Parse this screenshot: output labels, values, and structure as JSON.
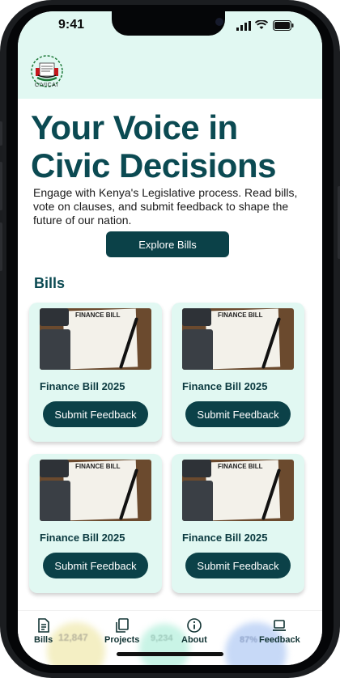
{
  "status_bar": {
    "time": "9:41"
  },
  "header": {
    "logo_text": "CIVICAI"
  },
  "hero": {
    "title": "Your Voice in Civic Decisions",
    "description": "Engage with Kenya's Legislative process. Read bills, vote on clauses, and submit feedback to shape the future of our nation.",
    "cta_label": "Explore Bills"
  },
  "bills": {
    "section_title": "Bills",
    "image_title": "FINANCE BILL",
    "items": [
      {
        "name": "Finance Bill 2025",
        "button_label": "Submit Feedback"
      },
      {
        "name": "Finance Bill 2025",
        "button_label": "Submit Feedback"
      },
      {
        "name": "Finance Bill 2025",
        "button_label": "Submit Feedback"
      },
      {
        "name": "Finance Bill 2025",
        "button_label": "Submit Feedback"
      }
    ]
  },
  "bottom_nav": {
    "items": [
      {
        "label": "Bills",
        "icon": "document-icon"
      },
      {
        "label": "Projects",
        "icon": "copy-icon"
      },
      {
        "label": "About",
        "icon": "info-icon"
      },
      {
        "label": "Feedback",
        "icon": "laptop-icon"
      }
    ],
    "background_stats": [
      "12,847",
      "9,234",
      "87%"
    ]
  },
  "colors": {
    "accent": "#0b4148",
    "title": "#0b4a52",
    "mint": "#e1f8f2"
  }
}
